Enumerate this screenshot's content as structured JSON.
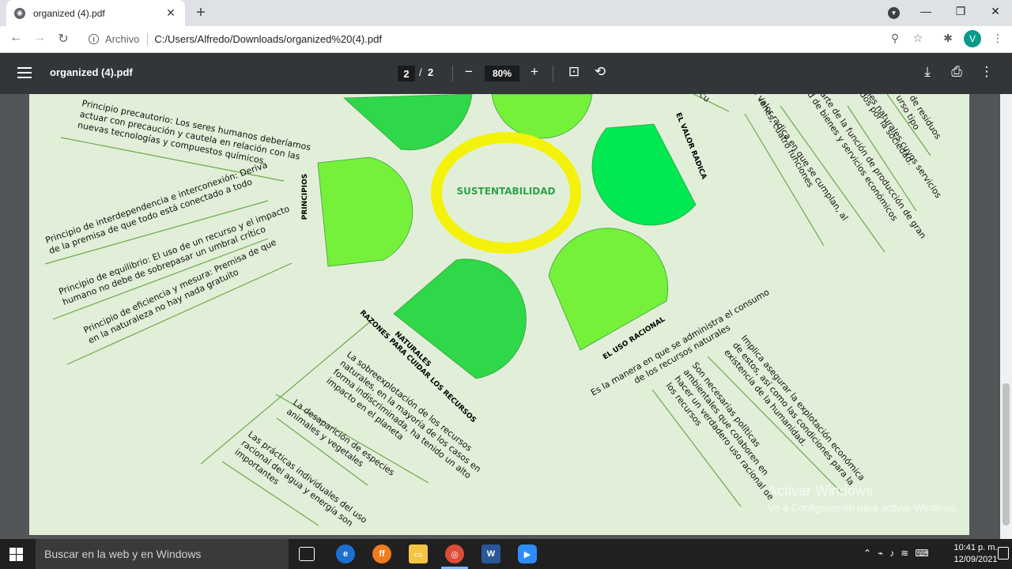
{
  "browser": {
    "tab_title": "organized (4).pdf",
    "url_scheme_label": "Archivo",
    "url": "C:/Users/Alfredo/Downloads/organized%20(4).pdf",
    "avatar_letter": "V"
  },
  "pdf": {
    "title": "organized (4).pdf",
    "current_page": "2",
    "page_separator": "/",
    "total_pages": "2",
    "zoom": "80%"
  },
  "map": {
    "center": "SUSTENTABILIDAD",
    "branch_principios": "PRINCIPIOS",
    "branch_valor": "EL VALOR RADICA",
    "branch_uso": "EL USO RACIONAL",
    "branch_razones_1": "RAZONES PARA CUIDAR LOS RECURSOS",
    "branch_razones_2": "NATURALES",
    "principios": [
      [
        "Principio precautorio: Los seres humanos deberíamos",
        "actuar con precaución y cautela en relación con las",
        "nuevas tecnologías y compuestos químicos"
      ],
      [
        "Principio de interdependencia e interconexión: Deriva",
        "de la premisa de que todo está conectado a todo"
      ],
      [
        "Principio de equilibrio: El uso de un recurso y el impacto",
        "humano no debe de sobrepasar un umbral crítico"
      ],
      [
        "Principio de eficiencia y mesura: Premisa de que",
        "en la naturaleza no hay nada gratuito"
      ]
    ],
    "valor": [
      [
        "cu"
      ],
      [
        "ienes, cuatro funciones"
      ],
      [
        "el valor radica en que se cumplan, al"
      ],
      [
        "d de bienes y servicios económicos"
      ],
      [
        "parte de la función de producción de gran"
      ],
      [
        "dos por la sociedad."
      ],
      [
        "ienes naturales cuyos servicios"
      ],
      [
        "urso tipo"
      ],
      [
        "or de residuos"
      ]
    ],
    "uso": [
      [
        "Es la manera en que se administra el consumo",
        "de los recursos naturales"
      ],
      [
        "Implica asegurar la explotación económica",
        "de estos, así como las condiciones para la",
        "existencia de la humanidad."
      ],
      [
        "Son necesarias políticas",
        "ambientales que colaboren en",
        "hacer un verdadero uso racional de",
        "los recursos"
      ]
    ],
    "razones": [
      [
        "La sobreexplotación de los recursos",
        "naturales, en la mayoría de los casos en",
        "forma indiscriminada, ha tenido un alto",
        "impacto en el planeta"
      ],
      [
        "La desaparición de especies",
        "animales y vegetales"
      ],
      [
        "Las prácticas individuales del uso",
        "racional del agua y energía son",
        "importantes"
      ]
    ]
  },
  "watermark": {
    "line1": "Activar Windows",
    "line2": "Ve a Configuración para activar Windows."
  },
  "taskbar": {
    "search_placeholder": "Buscar en la web y en Windows",
    "time": "10:41 p. m.",
    "date": "12/09/2021"
  },
  "colors": {
    "page_bg": "#e2efd8",
    "petal_light": "#76f13a",
    "petal_mid": "#2ed848",
    "petal_bright": "#00e852",
    "ring": "#f4f20a",
    "center_text": "#2ea24a",
    "line": "#6aa84f"
  }
}
